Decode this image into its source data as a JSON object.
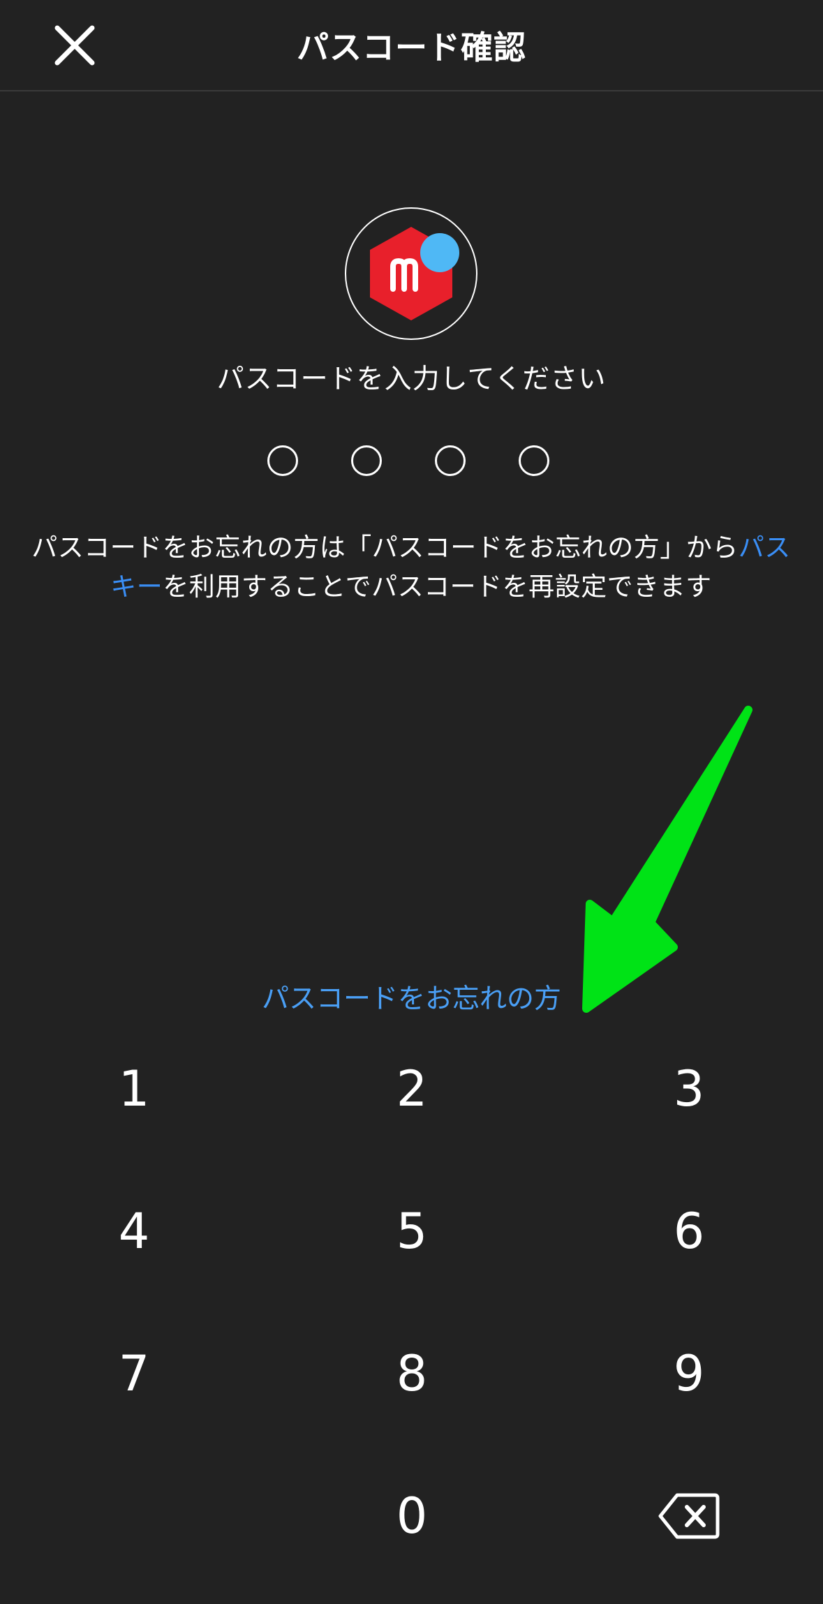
{
  "header": {
    "title": "パスコード確認"
  },
  "prompt": "パスコードを入力してください",
  "info": {
    "before_link": "パスコードをお忘れの方は「パスコードをお忘れの方」から",
    "link": "パスキー",
    "after_link": "を利用することでパスコードを再設定できます"
  },
  "forgot_link": "パスコードをお忘れの方",
  "keypad": {
    "k1": "1",
    "k2": "2",
    "k3": "3",
    "k4": "4",
    "k5": "5",
    "k6": "6",
    "k7": "7",
    "k8": "8",
    "k9": "9",
    "k0": "0"
  },
  "colors": {
    "background": "#222222",
    "link": "#3a8ef5",
    "logo_red": "#e8202b",
    "logo_dot": "#4fb8f5",
    "annotation_arrow": "#00e316"
  },
  "icons": {
    "close": "close-icon",
    "logo": "mercari-logo-icon",
    "backspace": "backspace-icon",
    "annotation": "arrow-annotation-icon"
  }
}
